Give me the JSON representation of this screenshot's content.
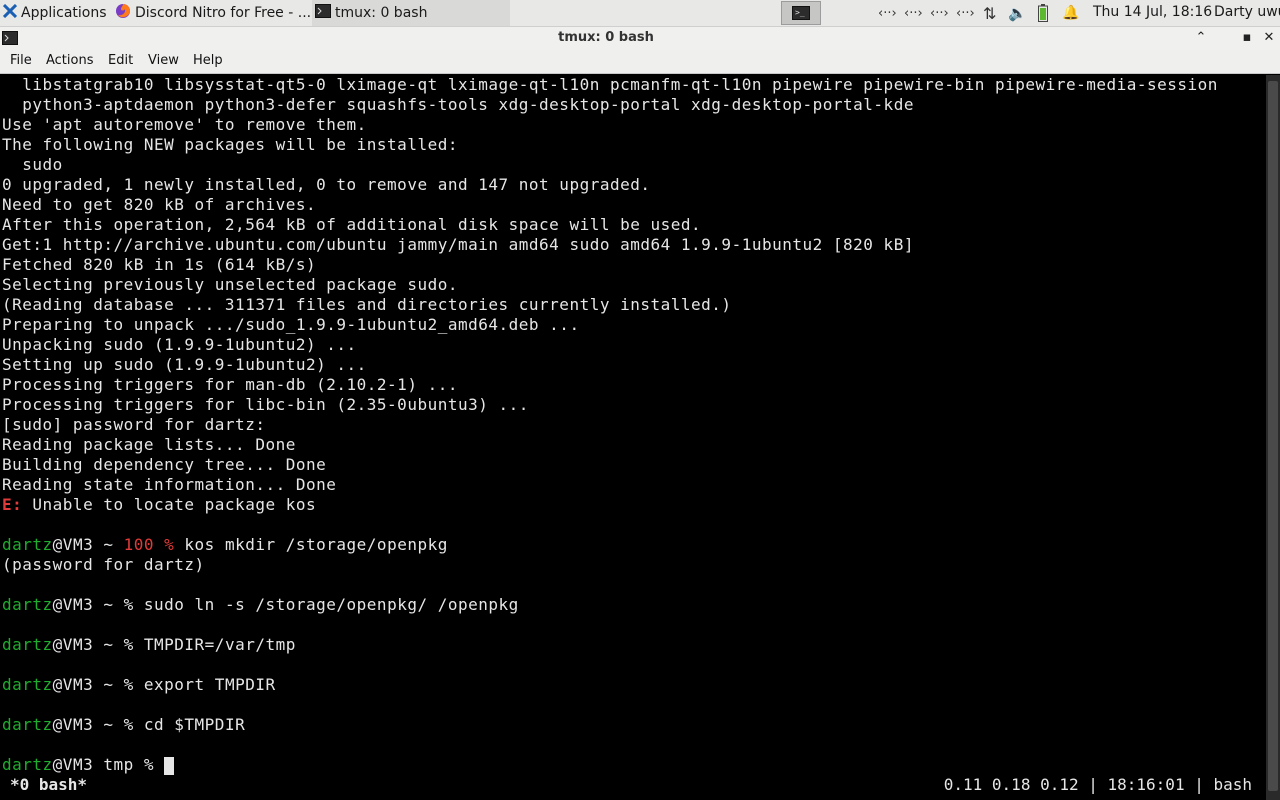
{
  "panel": {
    "applications_label": "Applications",
    "tasks": [
      {
        "label": "Discord Nitro for Free - ..."
      },
      {
        "label": "tmux: 0 bash"
      }
    ],
    "clock": "Thu 14 Jul, 18:16",
    "user": "Darty uwu",
    "net_glyph": "‹··›",
    "updown_glyph": "⇅",
    "volume_glyph": "🔈",
    "bell_glyph": "🔔"
  },
  "window": {
    "title": "tmux: 0 bash",
    "min_glyph": "⌃",
    "max_glyph": "▪",
    "close_glyph": "✕"
  },
  "menubar": [
    "File",
    "Actions",
    "Edit",
    "View",
    "Help"
  ],
  "terminal": {
    "lines": [
      "  libstatgrab10 libsysstat-qt5-0 lximage-qt lximage-qt-l10n pcmanfm-qt-l10n pipewire pipewire-bin pipewire-media-session",
      "  python3-aptdaemon python3-defer squashfs-tools xdg-desktop-portal xdg-desktop-portal-kde",
      "Use 'apt autoremove' to remove them.",
      "The following NEW packages will be installed:",
      "  sudo",
      "0 upgraded, 1 newly installed, 0 to remove and 147 not upgraded.",
      "Need to get 820 kB of archives.",
      "After this operation, 2,564 kB of additional disk space will be used.",
      "Get:1 http://archive.ubuntu.com/ubuntu jammy/main amd64 sudo amd64 1.9.9-1ubuntu2 [820 kB]",
      "Fetched 820 kB in 1s (614 kB/s)",
      "Selecting previously unselected package sudo.",
      "(Reading database ... 311371 files and directories currently installed.)",
      "Preparing to unpack .../sudo_1.9.9-1ubuntu2_amd64.deb ...",
      "Unpacking sudo (1.9.9-1ubuntu2) ...",
      "Setting up sudo (1.9.9-1ubuntu2) ...",
      "Processing triggers for man-db (2.10.2-1) ...",
      "Processing triggers for libc-bin (2.35-0ubuntu3) ...",
      "[sudo] password for dartz:",
      "Reading package lists... Done",
      "Building dependency tree... Done",
      "Reading state information... Done"
    ],
    "error_prefix": "E:",
    "error_text": " Unable to locate package kos",
    "prompt_user": "dartz",
    "prompt_host_home": "@VM3 ~ ",
    "prompt_host_tmp": "@VM3 tmp ",
    "prompt_status": "100 % ",
    "prompt_sign": "% ",
    "cmd1": "kos mkdir /storage/openpkg",
    "cmd1_out": "(password for dartz)",
    "cmd2": "sudo ln -s /storage/openpkg/ /openpkg",
    "cmd3": "TMPDIR=/var/tmp",
    "cmd4": "export TMPDIR",
    "cmd5": "cd $TMPDIR",
    "final_prompt": "% "
  },
  "tmux": {
    "window_label": "*0 bash*",
    "status_right": "0.11 0.18 0.12 | 18:16:01 | bash"
  },
  "colors": {
    "prompt_user": "#1fae2e",
    "error": "#e03a3a",
    "panel_bg": "#e8e8e7"
  }
}
